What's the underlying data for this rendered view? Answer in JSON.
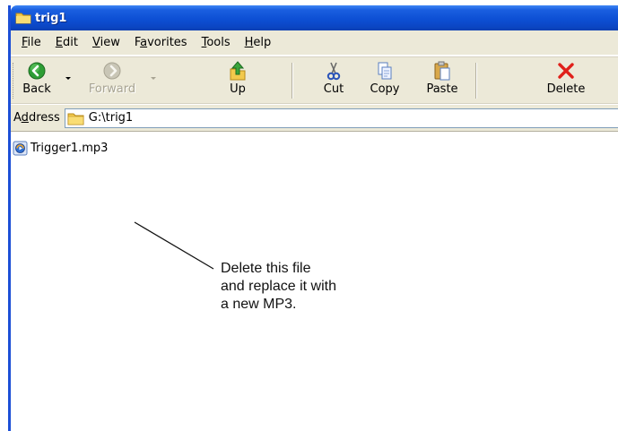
{
  "window": {
    "title": "trig1"
  },
  "menubar": {
    "items": [
      {
        "label": "File",
        "mnemonic": "F"
      },
      {
        "label": "Edit",
        "mnemonic": "E"
      },
      {
        "label": "View",
        "mnemonic": "V"
      },
      {
        "label": "Favorites",
        "mnemonic": "a"
      },
      {
        "label": "Tools",
        "mnemonic": "T"
      },
      {
        "label": "Help",
        "mnemonic": "H"
      }
    ]
  },
  "toolbar": {
    "back_label": "Back",
    "forward_label": "Forward",
    "up_label": "Up",
    "cut_label": "Cut",
    "copy_label": "Copy",
    "paste_label": "Paste",
    "delete_label": "Delete",
    "icons": {
      "back": "back-arrow-icon",
      "forward": "forward-arrow-icon",
      "up": "up-folder-icon",
      "cut": "scissors-icon",
      "copy": "copy-icon",
      "paste": "paste-icon",
      "delete": "delete-x-icon"
    }
  },
  "address": {
    "label": "Address",
    "mnemonic": "d",
    "value": "G:\\trig1"
  },
  "files": [
    {
      "name": "Trigger1.mp3",
      "icon": "media-file-icon"
    }
  ],
  "annotation": {
    "lines": [
      "Delete this file",
      "and replace it with",
      "a new MP3."
    ]
  },
  "colors": {
    "titlebar": "#0d4fd4",
    "chrome": "#ece9d8",
    "delete_red": "#e0201a",
    "back_green": "#2e9e35"
  }
}
